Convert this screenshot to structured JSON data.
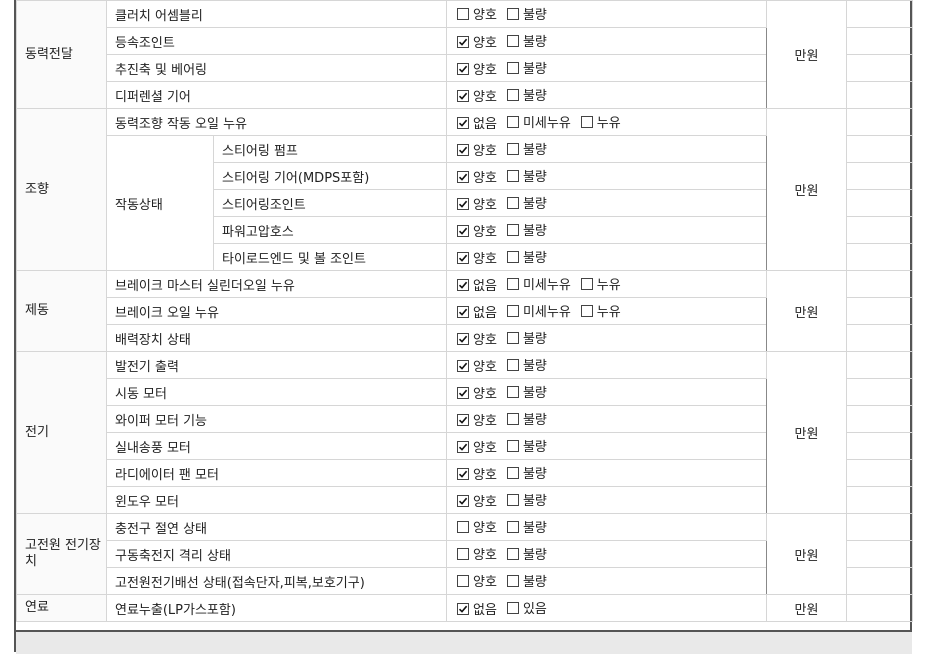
{
  "price_unit": "만원",
  "groups": [
    {
      "category": "동력전달",
      "rows": [
        {
          "item": "클러치 어셈블리",
          "options": [
            {
              "label": "양호",
              "checked": false
            },
            {
              "label": "불량",
              "checked": false
            }
          ]
        },
        {
          "item": "등속조인트",
          "options": [
            {
              "label": "양호",
              "checked": true
            },
            {
              "label": "불량",
              "checked": false
            }
          ]
        },
        {
          "item": "추진축 및 베어링",
          "options": [
            {
              "label": "양호",
              "checked": true
            },
            {
              "label": "불량",
              "checked": false
            }
          ]
        },
        {
          "item": "디퍼렌셜 기어",
          "options": [
            {
              "label": "양호",
              "checked": true
            },
            {
              "label": "불량",
              "checked": false
            }
          ]
        }
      ]
    },
    {
      "category": "조향",
      "subgroup_label": "작동상태",
      "rows": [
        {
          "item": "동력조향 작동 오일 누유",
          "options": [
            {
              "label": "없음",
              "checked": true
            },
            {
              "label": "미세누유",
              "checked": false
            },
            {
              "label": "누유",
              "checked": false
            }
          ]
        },
        {
          "sub": "스티어링 펌프",
          "options": [
            {
              "label": "양호",
              "checked": true
            },
            {
              "label": "불량",
              "checked": false
            }
          ]
        },
        {
          "sub": "스티어링 기어(MDPS포함)",
          "options": [
            {
              "label": "양호",
              "checked": true
            },
            {
              "label": "불량",
              "checked": false
            }
          ]
        },
        {
          "sub": "스티어링조인트",
          "options": [
            {
              "label": "양호",
              "checked": true
            },
            {
              "label": "불량",
              "checked": false
            }
          ]
        },
        {
          "sub": "파워고압호스",
          "options": [
            {
              "label": "양호",
              "checked": true
            },
            {
              "label": "불량",
              "checked": false
            }
          ]
        },
        {
          "sub": "타이로드엔드 및 볼 조인트",
          "options": [
            {
              "label": "양호",
              "checked": true
            },
            {
              "label": "불량",
              "checked": false
            }
          ]
        }
      ]
    },
    {
      "category": "제동",
      "rows": [
        {
          "item": "브레이크 마스터 실린더오일 누유",
          "options": [
            {
              "label": "없음",
              "checked": true
            },
            {
              "label": "미세누유",
              "checked": false
            },
            {
              "label": "누유",
              "checked": false
            }
          ]
        },
        {
          "item": "브레이크 오일 누유",
          "options": [
            {
              "label": "없음",
              "checked": true
            },
            {
              "label": "미세누유",
              "checked": false
            },
            {
              "label": "누유",
              "checked": false
            }
          ]
        },
        {
          "item": "배력장치 상태",
          "options": [
            {
              "label": "양호",
              "checked": true
            },
            {
              "label": "불량",
              "checked": false
            }
          ]
        }
      ]
    },
    {
      "category": "전기",
      "rows": [
        {
          "item": "발전기 출력",
          "options": [
            {
              "label": "양호",
              "checked": true
            },
            {
              "label": "불량",
              "checked": false
            }
          ]
        },
        {
          "item": "시동 모터",
          "options": [
            {
              "label": "양호",
              "checked": true
            },
            {
              "label": "불량",
              "checked": false
            }
          ]
        },
        {
          "item": "와이퍼 모터 기능",
          "options": [
            {
              "label": "양호",
              "checked": true
            },
            {
              "label": "불량",
              "checked": false
            }
          ]
        },
        {
          "item": "실내송풍 모터",
          "options": [
            {
              "label": "양호",
              "checked": true
            },
            {
              "label": "불량",
              "checked": false
            }
          ]
        },
        {
          "item": "라디에이터 팬 모터",
          "options": [
            {
              "label": "양호",
              "checked": true
            },
            {
              "label": "불량",
              "checked": false
            }
          ]
        },
        {
          "item": "윈도우 모터",
          "options": [
            {
              "label": "양호",
              "checked": true
            },
            {
              "label": "불량",
              "checked": false
            }
          ]
        }
      ]
    },
    {
      "category": "고전원 전기장치",
      "rows": [
        {
          "item": "충전구 절연 상태",
          "options": [
            {
              "label": "양호",
              "checked": false
            },
            {
              "label": "불량",
              "checked": false
            }
          ]
        },
        {
          "item": "구동축전지 격리 상태",
          "options": [
            {
              "label": "양호",
              "checked": false
            },
            {
              "label": "불량",
              "checked": false
            }
          ]
        },
        {
          "item": "고전원전기배선 상태(접속단자,피복,보호기구)",
          "options": [
            {
              "label": "양호",
              "checked": false
            },
            {
              "label": "불량",
              "checked": false
            }
          ]
        }
      ]
    },
    {
      "category": "연료",
      "rows": [
        {
          "item": "연료누출(LP가스포함)",
          "options": [
            {
              "label": "없음",
              "checked": true
            },
            {
              "label": "있음",
              "checked": false
            }
          ]
        }
      ]
    }
  ]
}
